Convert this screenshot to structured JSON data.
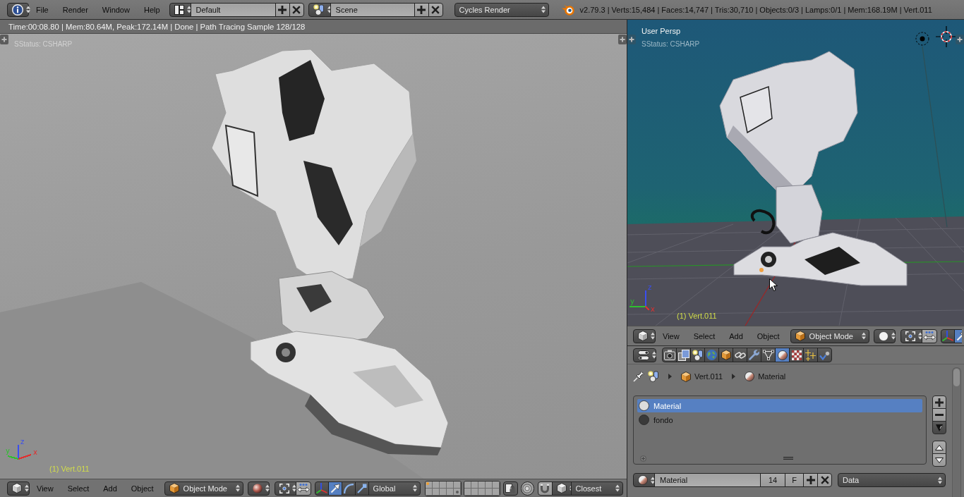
{
  "info_header": {
    "menus": [
      "File",
      "Render",
      "Window",
      "Help"
    ],
    "screen_layout": "Default",
    "scene": "Scene",
    "render_engine": "Cycles Render",
    "stats": "v2.79.3 | Verts:15,484 | Faces:14,747 | Tris:30,710 | Objects:0/3 | Lamps:0/1 | Mem:168.19M | Vert.011"
  },
  "left_viewport": {
    "render_stats": "Time:00:08.80 | Mem:80.64M, Peak:172.14M | Done | Path Tracing Sample 128/128",
    "status_text": "SStatus: CSHARP",
    "object_label": "(1) Vert.011",
    "axes": [
      {
        "kind": "z",
        "label": "z",
        "color": "#3a4ef0"
      },
      {
        "kind": "y",
        "label": "y",
        "color": "#2ec02e"
      },
      {
        "kind": "x",
        "label": "x",
        "color": "#e03030"
      }
    ],
    "header": {
      "menus": [
        "View",
        "Select",
        "Add",
        "Object"
      ],
      "mode": "Object Mode",
      "shading": {
        "kind": "rendered"
      },
      "pivot_align_on": false,
      "manipulators": [
        {
          "kind": "axes",
          "selected": false
        },
        {
          "kind": "translate",
          "selected": true
        },
        {
          "kind": "rotate",
          "selected": false
        },
        {
          "kind": "scale",
          "selected": false
        }
      ],
      "orientation": "Global",
      "layers": [
        {
          "active_object": true,
          "has_objects": false
        },
        {
          "active_object": false,
          "has_objects": false
        },
        {
          "active_object": false,
          "has_objects": false
        },
        {
          "active_object": false,
          "has_objects": false
        },
        {
          "active_object": false,
          "has_objects": false
        },
        {
          "active_object": false,
          "has_objects": false
        },
        {
          "active_object": false,
          "has_objects": false
        },
        {
          "active_object": false,
          "has_objects": false
        },
        {
          "active_object": false,
          "has_objects": false
        },
        {
          "active_object": false,
          "has_objects": true
        },
        {
          "active_object": false,
          "has_objects": false
        },
        {
          "active_object": false,
          "has_objects": false
        },
        {
          "active_object": false,
          "has_objects": false
        },
        {
          "active_object": false,
          "has_objects": false
        },
        {
          "active_object": false,
          "has_objects": false
        },
        {
          "active_object": false,
          "has_objects": false
        },
        {
          "active_object": false,
          "has_objects": false
        },
        {
          "active_object": false,
          "has_objects": false
        },
        {
          "active_object": false,
          "has_objects": false
        },
        {
          "active_object": false,
          "has_objects": false
        }
      ],
      "lock_on": true,
      "proportional_on": false,
      "snap_on": false,
      "snap_target": "Closest"
    }
  },
  "right_viewport": {
    "view_name": "User Persp",
    "status_text": "SStatus: CSHARP",
    "object_label": "(1) Vert.011",
    "axes": [
      {
        "kind": "z",
        "label": "z",
        "color": "#3a4ef0"
      },
      {
        "kind": "y",
        "label": "y",
        "color": "#2ec02e"
      },
      {
        "kind": "x",
        "label": "x",
        "color": "#e03030"
      }
    ],
    "header": {
      "menus": [
        "View",
        "Select",
        "Add",
        "Object"
      ],
      "mode": "Object Mode",
      "shading": {
        "kind": "solid"
      },
      "pivot_align_on": false,
      "manipulators": [
        {
          "kind": "axes",
          "selected": false
        },
        {
          "kind": "translate",
          "selected": true
        }
      ]
    }
  },
  "properties": {
    "tabs": [
      {
        "kind": "render",
        "selected": false
      },
      {
        "kind": "render_layers",
        "selected": false
      },
      {
        "kind": "scene",
        "selected": false
      },
      {
        "kind": "world",
        "selected": false
      },
      {
        "kind": "object",
        "selected": false
      },
      {
        "kind": "constraints",
        "selected": false
      },
      {
        "kind": "modifiers",
        "selected": false
      },
      {
        "kind": "data",
        "selected": false
      },
      {
        "kind": "material",
        "selected": true
      },
      {
        "kind": "texture",
        "selected": false
      },
      {
        "kind": "particles",
        "selected": false
      },
      {
        "kind": "physics",
        "selected": false
      }
    ],
    "path": [
      {
        "kind": "scene"
      },
      {
        "kind": "object",
        "label": "Vert.011"
      },
      {
        "kind": "material",
        "label": "Material"
      }
    ],
    "slots": [
      {
        "name": "Material",
        "selected": true,
        "color": "#dcdcdc"
      },
      {
        "name": "fondo",
        "selected": false,
        "color": "#3a3a3a"
      }
    ],
    "material": {
      "name": "Material",
      "users": "14",
      "fake_user": "F",
      "link": "Data"
    }
  }
}
